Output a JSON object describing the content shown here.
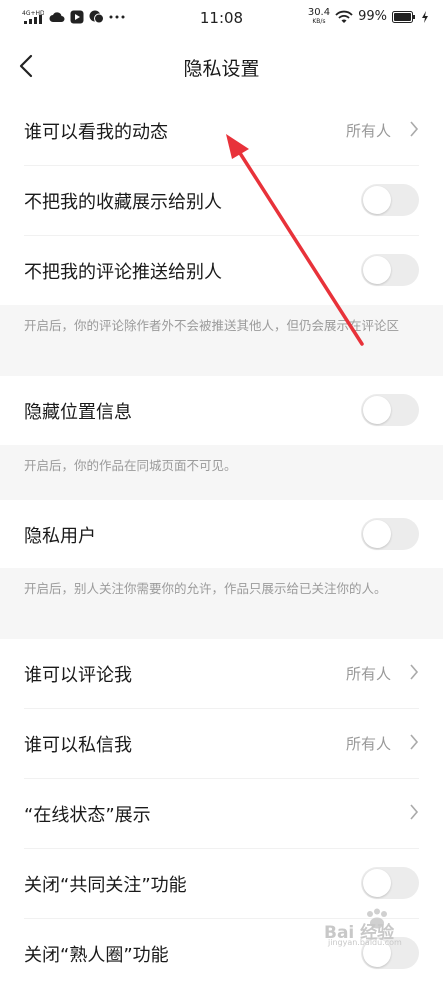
{
  "status_bar": {
    "network": "4G+HD",
    "time": "11:08",
    "net_speed_value": "30.4",
    "net_speed_unit": "KB/s",
    "battery": "99%",
    "icons": [
      "signal-icon",
      "cloud-icon",
      "video-app-icon",
      "chat-app-icon",
      "more-dots-icon",
      "wifi-icon",
      "battery-icon",
      "charging-icon"
    ]
  },
  "nav": {
    "title": "隐私设置",
    "back_icon": "chevron-left-icon"
  },
  "rows": {
    "who_can_see": {
      "label": "谁可以看我的动态",
      "value": "所有人"
    },
    "hide_favorites": {
      "label": "不把我的收藏展示给别人",
      "enabled": false
    },
    "hide_comments": {
      "label": "不把我的评论推送给别人",
      "enabled": false
    },
    "hide_location": {
      "label": "隐藏位置信息",
      "enabled": false
    },
    "private_user": {
      "label": "隐私用户",
      "enabled": false
    },
    "who_can_comment": {
      "label": "谁可以评论我",
      "value": "所有人"
    },
    "who_can_message": {
      "label": "谁可以私信我",
      "value": "所有人"
    },
    "online_status": {
      "label": "“在线状态”展示"
    },
    "close_mutual": {
      "label": "关闭“共同关注”功能",
      "enabled": false
    },
    "close_acquaintance": {
      "label": "关闭“熟人圈”功能",
      "enabled": false
    }
  },
  "notes": {
    "comments": "开启后，你的评论除作者外不会被推送其他人，但仍会展示在评论区",
    "location": "开启后，你的作品在同城页面不可见。",
    "private": "开启后，别人关注你需要你的允许，作品只展示给已关注你的人。"
  },
  "colors": {
    "annotation_arrow": "#e8323a",
    "toggle_off": "#ececec",
    "secondary_text": "#999999",
    "section_bg": "#f6f6f6"
  },
  "watermark": {
    "brand": "Bai 经验",
    "url": "jingyan.baidu.com"
  }
}
